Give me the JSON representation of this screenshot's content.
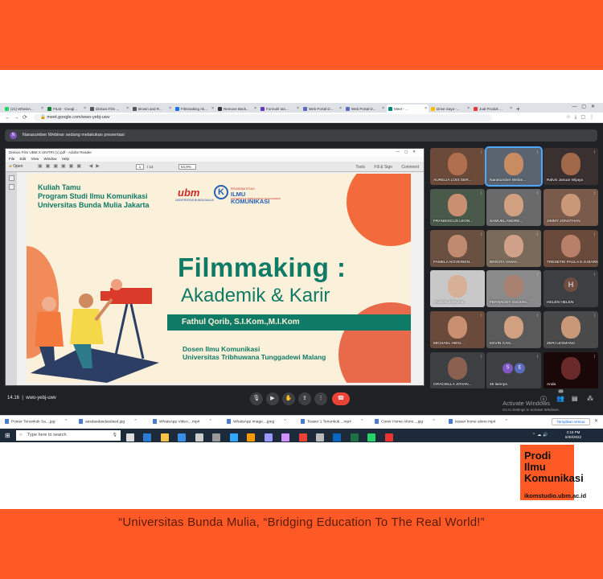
{
  "browser": {
    "tabs": [
      {
        "label": "(21) WhatsA...",
        "color": "#25d366"
      },
      {
        "label": "FILM - Googl...",
        "color": "#188038"
      },
      {
        "label": "Diskusi Film ...",
        "color": "#555555"
      },
      {
        "label": "Brown and R...",
        "color": "#555555"
      },
      {
        "label": "Filmmaking Ak...",
        "color": "#1a73e8"
      },
      {
        "label": "Remove Back...",
        "color": "#333333"
      },
      {
        "label": "Formulir tan...",
        "color": "#673ab7"
      },
      {
        "label": "Web Portal D...",
        "color": "#5c6bc0"
      },
      {
        "label": "Web Portal D...",
        "color": "#5c6bc0"
      },
      {
        "label": "Meet - ...",
        "color": "#00897b"
      },
      {
        "label": "Drive Saya -...",
        "color": "#fbbc04"
      },
      {
        "label": "Jual Produk ...",
        "color": "#e53935"
      }
    ],
    "url": "meet.google.com/wwo-yebj-uwv"
  },
  "meet": {
    "presenter_avatar": "N",
    "presenter_banner": "Narasumber Webinar sedang melakukan presentasi",
    "meeting_time": "14.16",
    "meeting_code": "wwo-yebj-uwv",
    "participants_badge": "49",
    "participants": [
      {
        "name": "AURELIA LOIS SER...",
        "skin": "#b07050",
        "bg": "#6b4a3a"
      },
      {
        "name": "Narasumber Webin...",
        "skin": "#c98c62",
        "bg": "#5a6470",
        "highlight": true
      },
      {
        "name": "Ralvin Januar Wijaya",
        "skin": "#a0684a",
        "bg": "#3a3030"
      },
      {
        "name": "FRANSISCUS LEON...",
        "skin": "#c89070",
        "bg": "#4a5a4a"
      },
      {
        "name": "SAMUEL ANDRE...",
        "skin": "#d0a080",
        "bg": "#6a6a6a"
      },
      {
        "name": "JIMMY JONATHAN",
        "skin": "#c89878",
        "bg": "#7a5a4a"
      },
      {
        "name": "FAMELA NOVERIEN...",
        "skin": "#c08a70",
        "bg": "#6a5040"
      },
      {
        "name": "BRIGITA VANIA...",
        "skin": "#d0a088",
        "bg": "#7a6a5a"
      },
      {
        "name": "TRESETIE PAULA E.S.MARKING",
        "skin": "#b88068",
        "bg": "#6a4a3a"
      },
      {
        "name": "ANSON STEVAN...",
        "skin": "#d8b098",
        "bg": "#c8c8c8"
      },
      {
        "name": "FERNADDY SUDIAN...",
        "skin": "#a88070",
        "bg": "#8a8a8a"
      },
      {
        "name": "HELEN HELEN",
        "initial": "H"
      },
      {
        "name": "MICHAEL HIEN...",
        "skin": "#c89070",
        "bg": "#6a4a3a"
      },
      {
        "name": "KEVIN CAN...",
        "skin": "#d0a080",
        "bg": "#5a5a5a"
      },
      {
        "name": "ZERI LESMANA",
        "skin": "#c89878",
        "bg": "#4a4a4a"
      },
      {
        "name": "GRACIELLA JOVAN...",
        "skin": "#8a6050",
        "bg": "#3c4043"
      },
      {
        "name": "45 lainnya",
        "others": [
          "S",
          "E"
        ]
      },
      {
        "name": "Anda",
        "skin": "#6a2a2a",
        "bg": "#1a0808"
      }
    ],
    "activate_title": "Activate Windows",
    "activate_sub": "Go to Settings to activate Windows."
  },
  "reader": {
    "title": "Diskusi Film UBM X UNITRI (1).pdf - Adobe Reader",
    "menu": [
      "File",
      "Edit",
      "View",
      "Window",
      "Help"
    ],
    "open_label": "Open",
    "page_current": "1",
    "page_total": "/ 14",
    "zoom": "54,9%",
    "right_tools": [
      "Tools",
      "Fill & Sign",
      "Comment"
    ]
  },
  "slide": {
    "guest_line1": "Kuliah Tamu",
    "guest_line2": "Program Studi Ilmu Komunikasi",
    "guest_line3": "Universitas Bunda Mulia Jakarta",
    "logo_ubm": "ubm",
    "logo_ubm_sub": "UNIVERSITAS BUNDA MULIA",
    "logo_ik_top": "PROGRAM STUDI",
    "logo_ik_main": "ILMU KOMUNIKASI",
    "logo_ik_bottom": "UNIVERSITAS TRIBHUWANA TUNGGADEWI",
    "title": "Filmmaking :",
    "subtitle": "Akademik & Karir",
    "speaker": "Fathul Qorib, S.I.Kom.,M.I.Kom",
    "dosen_line1": "Dosen Ilmu Komunikasi",
    "dosen_line2": "Universitas Tribhuwana Tunggadewi Malang"
  },
  "downloads": {
    "items": [
      "Poster Tenunkuk Sa....jpg",
      "aasdasdasdasdasd.jpg",
      "WhatsApp Video....mp4",
      "WhatsApp Image....jpeg",
      "Teaser 1 Tenunkuk....mp4",
      "Cover Home Alone....jpg",
      "teaser home alone.mp4"
    ],
    "show_all": "Tampilkan semua"
  },
  "taskbar": {
    "search_placeholder": "Type here to search",
    "time": "2:16 PM",
    "date": "5/30/2022"
  },
  "badge": {
    "line1": "Prodi",
    "line2": "Ilmu",
    "line3": "Komunikasi",
    "url": "ikomstudio.ubm.ac.id"
  },
  "tagline": "“Universitas Bunda Mulia, “Bridging Education To The Real World!”"
}
